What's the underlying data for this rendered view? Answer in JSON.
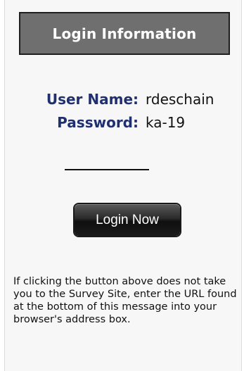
{
  "header": {
    "title": "Login Information"
  },
  "credentials": {
    "user_label": "User Name:",
    "user_value": "rdeschain",
    "pass_label": "Password:",
    "pass_value": "ka-19"
  },
  "actions": {
    "login_label": "Login Now"
  },
  "help": {
    "text": "If clicking the button above does not take you to the Survey Site, enter the URL found at the bottom of this message into your browser's address box."
  },
  "colors": {
    "header_bg": "#6f6f6f",
    "label_color": "#1f2f6f",
    "panel_bg": "#f7f7f7"
  }
}
